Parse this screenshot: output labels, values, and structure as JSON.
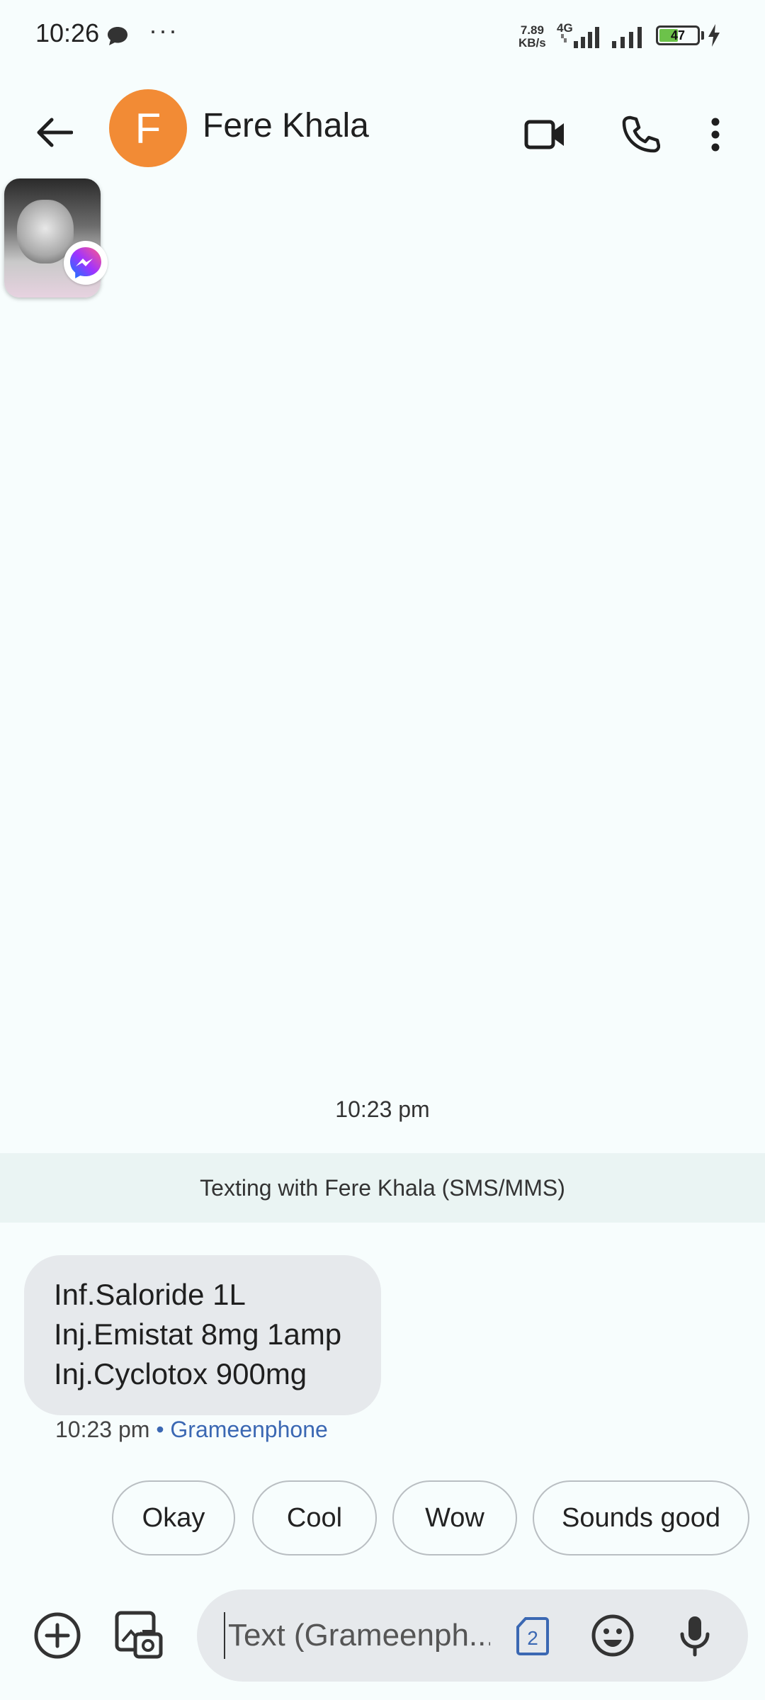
{
  "status_bar": {
    "time": "10:26",
    "more": "···",
    "net_speed_value": "7.89",
    "net_speed_unit": "KB/s",
    "network_type": "4G",
    "battery": "47"
  },
  "header": {
    "avatar_letter": "F",
    "contact_name": "Fere Khala",
    "avatar_color": "#f28b35"
  },
  "conversation": {
    "timestamp": "10:23 pm",
    "banner": "Texting with Fere Khala (SMS/MMS)",
    "messages": [
      {
        "lines": [
          "Inf.Saloride 1L",
          "Inj.Emistat 8mg 1amp",
          "Inj.Cyclotox 900mg"
        ],
        "time": "10:23 pm",
        "separator": " • ",
        "carrier": "Grameenphone"
      }
    ]
  },
  "smart_replies": [
    "Okay",
    "Cool",
    "Wow",
    "Sounds good"
  ],
  "compose": {
    "placeholder": "Text (Grameenph...",
    "sim_number": "2"
  },
  "colors": {
    "background": "#f7fdfd",
    "bubble": "#e6e9ec",
    "carrier_link": "#3b68b3"
  }
}
